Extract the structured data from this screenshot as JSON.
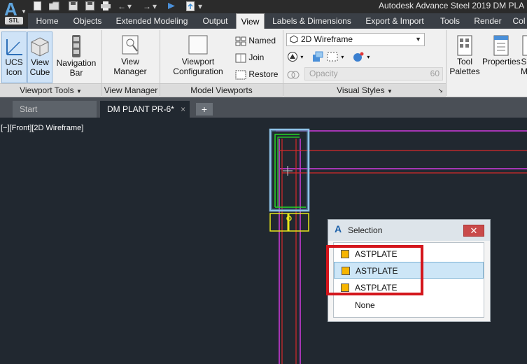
{
  "app": {
    "title": "Autodesk Advance Steel 2019   DM PLA",
    "logo_letter": "A",
    "logo_badge": "STL"
  },
  "quick_access": [
    "new-icon",
    "open-icon",
    "save-icon",
    "saveas-icon",
    "print-icon",
    "undo-icon",
    "redo-icon",
    "share-icon",
    "publish-icon"
  ],
  "ribbon_tabs": [
    "Home",
    "Objects",
    "Extended Modeling",
    "Output",
    "View",
    "Labels & Dimensions",
    "Export & Import",
    "Tools",
    "Render",
    "Col"
  ],
  "ribbon_active_tab": "View",
  "ribbon": {
    "viewport_tools": {
      "label": "Viewport Tools",
      "ucs_icon": "UCS Icon",
      "view_cube": "View Cube",
      "navigation_bar": "Navigation Bar"
    },
    "view_manager": {
      "label": "View Manager",
      "button": "View Manager"
    },
    "model_viewports": {
      "label": "Model Viewports",
      "viewport_config": "Viewport Configuration",
      "named": "Named",
      "join": "Join",
      "restore": "Restore"
    },
    "visual_styles": {
      "label": "Visual Styles",
      "selected_style": "2D Wireframe",
      "opacity_placeholder": "Opacity",
      "opacity_value": "60"
    },
    "palettes": {
      "tool_palettes": "Tool Palettes",
      "properties": "Properties",
      "cut_off": "S M"
    }
  },
  "doc_tabs": {
    "start": "Start",
    "active": "DM PLANT PR-6*",
    "close": "×",
    "add": "+"
  },
  "viewport": {
    "label": "[−][Front][2D Wireframe]"
  },
  "selection_popup": {
    "title": "Selection",
    "close": "✕",
    "items": [
      {
        "label": "ASTPLATE",
        "highlighted": false
      },
      {
        "label": "ASTPLATE",
        "highlighted": true
      },
      {
        "label": "ASTPLATE",
        "highlighted": false
      },
      {
        "label": "None",
        "highlighted": false
      }
    ]
  },
  "colors": {
    "viewport_bg": "#212830",
    "swatch": "#f7b500",
    "annotation_red": "#d4161c",
    "magenta_lines": "#d13bdf",
    "red_lines": "#d62a2a",
    "green_lines": "#27d927",
    "yellow_lines": "#e6e61a",
    "selection_blue": "#8fc3e8"
  }
}
